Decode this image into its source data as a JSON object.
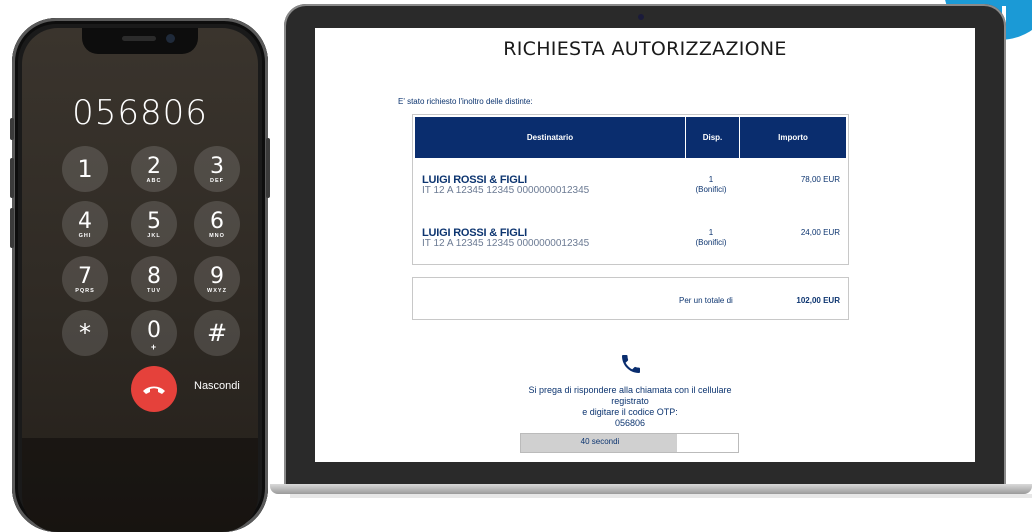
{
  "phone": {
    "dialed_number": "056806",
    "keys": [
      {
        "num": "1",
        "letters": ""
      },
      {
        "num": "2",
        "letters": "ABC"
      },
      {
        "num": "3",
        "letters": "DEF"
      },
      {
        "num": "4",
        "letters": "GHI"
      },
      {
        "num": "5",
        "letters": "JKL"
      },
      {
        "num": "6",
        "letters": "MNO"
      },
      {
        "num": "7",
        "letters": "PQRS"
      },
      {
        "num": "8",
        "letters": "TUV"
      },
      {
        "num": "9",
        "letters": "WXYZ"
      },
      {
        "num": "*",
        "letters": ""
      },
      {
        "num": "0",
        "letters": "+"
      },
      {
        "num": "#",
        "letters": ""
      }
    ],
    "hide_label": "Nascondi"
  },
  "screen": {
    "title": "RICHIESTA AUTORIZZAZIONE",
    "intro": "E' stato richiesto l'inoltro delle distinte:",
    "table": {
      "headers": [
        "Destinatario",
        "Disp.",
        "Importo"
      ],
      "rows": [
        {
          "name": "LUIGI ROSSI & FIGLI",
          "iban": "IT 12 A 12345 12345 0000000012345",
          "disp_count": "1",
          "disp_type": "(Bonifici)",
          "amount": "78,00 EUR"
        },
        {
          "name": "LUIGI ROSSI & FIGLI",
          "iban": "IT 12 A 12345 12345 0000000012345",
          "disp_count": "1",
          "disp_type": "(Bonifici)",
          "amount": "24,00 EUR"
        }
      ]
    },
    "total_label": "Per un totale di",
    "total_value": "102,00 EUR",
    "message_lines": [
      "Si prega di rispondere alla chiamata con il cellulare",
      "registrato",
      "e digitare il codice OTP:",
      "056806"
    ],
    "timer_label": "40 secondi",
    "timer_progress": 0.72
  },
  "colors": {
    "header_blue": "#0a2d6e",
    "text_blue": "#0d3570",
    "end_call_red": "#e5413b",
    "accent_cyan": "#1b9ad6"
  }
}
